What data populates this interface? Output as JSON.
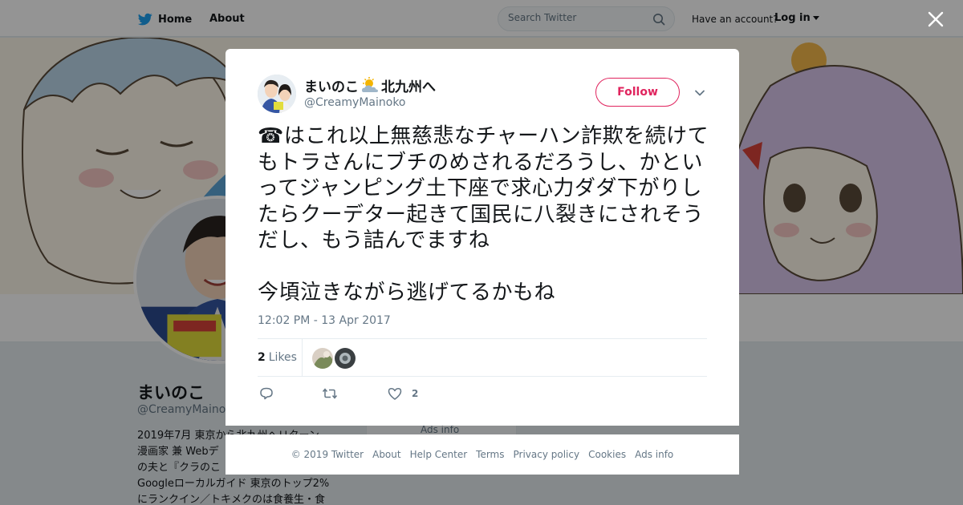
{
  "nav": {
    "home_label": "Home",
    "about_label": "About",
    "search_placeholder": "Search Twitter",
    "have_account": "Have an account?",
    "login_label": "Log in"
  },
  "profile": {
    "name": "まいのこ",
    "handle": "@CreamyMainoko",
    "bio_lines": [
      "2019年7月 東京から北九州へＵターン",
      "漫画家 兼 Webデ",
      "の夫と『クラのこ",
      "Googleローカルガイド 東京のトップ2%",
      "にランクイン／トキメクのは食養生・食"
    ]
  },
  "ads_info_card": "Ads info",
  "modal": {
    "author_name_before": "まいのこ",
    "author_name_after": "北九州へ",
    "author_handle": "@CreamyMainoko",
    "follow_label": "Follow",
    "tweet_text": "☎はこれ以上無慈悲なチャーハン詐欺を続けてもトラさんにブチのめされるだろうし、かといってジャンピング土下座で求心力ダダ下がりしたらクーデター起きて国民に八裂きにされそうだし、もう詰んでますね\n\n今頃泣きながら逃げてるかもね",
    "timestamp": "12:02 PM - 13 Apr 2017",
    "likes_count": "2",
    "likes_label": "Likes",
    "like_action_count": "2"
  },
  "footer": {
    "links": [
      "© 2019 Twitter",
      "About",
      "Help Center",
      "Terms",
      "Privacy policy",
      "Cookies",
      "Ads info"
    ]
  },
  "icons": {
    "twitter_logo": "twitter-bird-icon",
    "search": "search-icon",
    "close": "close-icon",
    "chevron": "chevron-down-icon",
    "reply": "reply-icon",
    "retweet": "retweet-icon",
    "like": "heart-icon",
    "weather": "sun-cloud-icon"
  },
  "colors": {
    "twitter_blue": "#1da1f2",
    "follow_accent": "#e0245e",
    "secondary_text": "#657786"
  }
}
